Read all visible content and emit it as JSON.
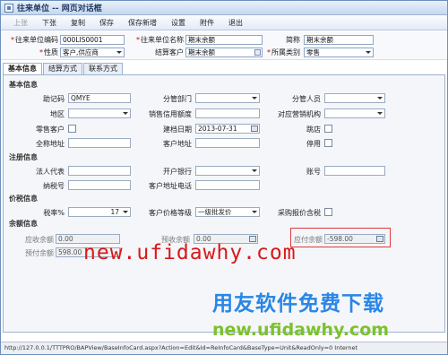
{
  "window": {
    "title": "往来单位 -- 网页对话框"
  },
  "toolbar": {
    "buttons": [
      "上张",
      "下张",
      "复制",
      "保存",
      "保存新增",
      "设置",
      "附件",
      "退出"
    ]
  },
  "header": {
    "code_label": "往来单位编码",
    "code_value": "000LIS0001",
    "name_label": "往来单位名称",
    "name_value": "期末余额",
    "short_label": "简称",
    "short_value": "期末余额",
    "nature_label": "性质",
    "nature_value": "客户,供应商",
    "settle_label": "结算客户",
    "settle_value": "期末余额",
    "category_label": "所属类别",
    "category_value": "零售"
  },
  "tabs": [
    "基本信息",
    "结算方式",
    "联系方式"
  ],
  "basic": {
    "section": "基本信息",
    "mnemonic_label": "助记码",
    "mnemonic_value": "QMYE",
    "dept_label": "分管部门",
    "staff_label": "分管人员",
    "region_label": "地区",
    "credit_label": "销售信用额度",
    "org_label": "对应营销机构",
    "retail_label": "零售客户",
    "created_label": "建档日期",
    "created_value": "2013-07-31",
    "closed_label": "跳店",
    "fulladdr_label": "全称地址",
    "addr_label": "客户地址",
    "disabled_label": "停用"
  },
  "register": {
    "section": "注册信息",
    "legal_label": "法人代表",
    "bank_label": "开户银行",
    "account_label": "账号",
    "taxno_label": "纳税号",
    "addrphone_label": "客户地址电话"
  },
  "price": {
    "section": "价税信息",
    "taxrate_label": "税率%",
    "taxrate_value": "17",
    "pricelevel_label": "客户价格等级",
    "pricelevel_value": "一级批发价",
    "purchase_label": "采购报价含税"
  },
  "balance": {
    "section": "余额信息",
    "receivable_label": "应收余额",
    "receivable_value": "0.00",
    "prepaid_label": "预收余额",
    "prepaid_value": "0.00",
    "payable_label": "应付余额",
    "payable_value": "-598.00",
    "advance_label": "预付余额",
    "advance_value": "598.00"
  },
  "watermark": {
    "url1": "new.ufidawhy.com",
    "slogan": "用友软件免费下载",
    "url2": "new.ufidawhy.com"
  },
  "status": {
    "text": "http://127.0.0.1/TTTPRO/BAPView/BaseInfoCard.aspx?Action=Edit&Id=ReInfoCard&BaseType=Unit&ReadOnly=0   Internet"
  },
  "colors": {
    "highlight": "#e13a3a",
    "watermark_red": "#d91818",
    "watermark_blue": "#2a86e6",
    "watermark_green": "#7cc22a"
  }
}
